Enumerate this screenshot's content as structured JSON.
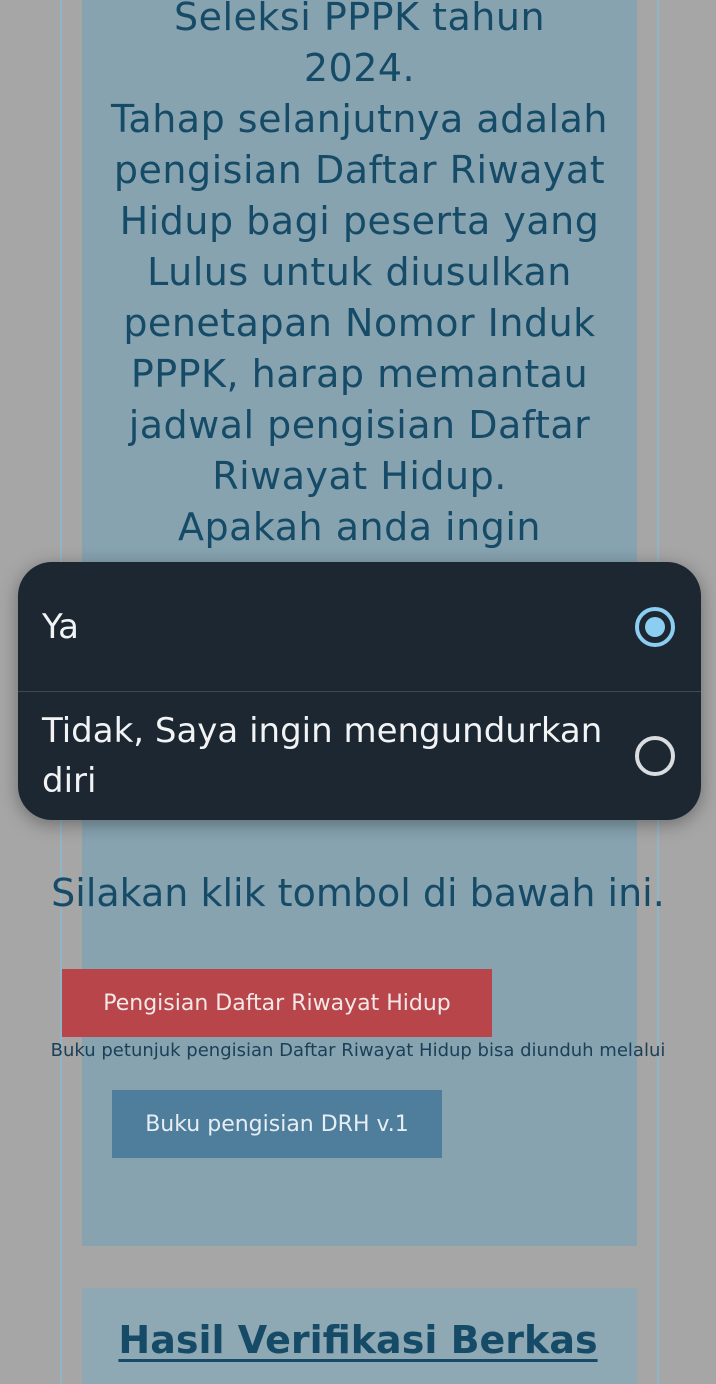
{
  "announcement": {
    "line1": "Seleksi PPPK tahun",
    "line2": "2024.",
    "para2": "Tahap selanjutnya adalah pengisian Daftar Riwayat Hidup bagi peserta yang Lulus untuk diusulkan penetapan Nomor Induk PPPK, harap memantau jadwal pengisian Daftar Riwayat Hidup.",
    "question": "Apakah anda ingin"
  },
  "dialog": {
    "options": [
      {
        "label": "Ya",
        "selected": true
      },
      {
        "label": "Tidak, Saya ingin mengundurkan diri",
        "selected": false
      }
    ]
  },
  "instruction": "Silakan klik tombol di bawah ini.",
  "buttons": {
    "drh_label": "Pengisian Daftar Riwayat Hidup",
    "guide_label": "Buku pengisian DRH v.1"
  },
  "guide_note": "Buku petunjuk pengisian Daftar Riwayat Hidup bisa diunduh melalui",
  "section": {
    "title": "Hasil Verifikasi Berkas"
  },
  "colors": {
    "card": "#87a3b0",
    "text": "#164b68",
    "primary_button": "#b8454a",
    "secondary_button": "#4f7d9c",
    "dialog_bg": "#1d2731",
    "radio_selected": "#8ccdf2"
  }
}
